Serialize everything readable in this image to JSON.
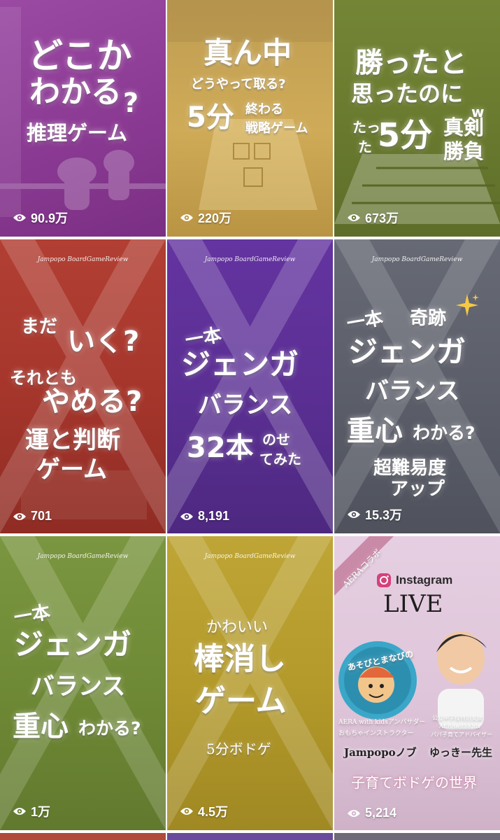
{
  "tiles": [
    {
      "lines": [
        "どこか",
        "わかる",
        "?",
        "推理ゲーム"
      ],
      "views": "90.9万"
    },
    {
      "lines": [
        "真ん中",
        "どうやって取る?",
        "5分",
        "終わる",
        "戦略ゲーム"
      ],
      "views": "220万"
    },
    {
      "lines": [
        "勝ったと",
        "思ったのに",
        "w",
        "たっ",
        "た",
        "5分",
        "真剣",
        "勝負"
      ],
      "views": "673万"
    },
    {
      "watermark": "Jampopo BoardGameReview",
      "lines": [
        "まだ",
        "いく?",
        "それとも",
        "やめる?",
        "運と判断",
        "ゲーム"
      ],
      "views": "701"
    },
    {
      "watermark": "Jampopo BoardGameReview",
      "lines": [
        "一本",
        "ジェンガ",
        "バランス",
        "32本",
        "のせ",
        "てみた"
      ],
      "views": "8,191"
    },
    {
      "watermark": "Jampopo BoardGameReview",
      "lines": [
        "一本",
        "奇跡",
        "ジェンガ",
        "バランス",
        "重心",
        "わかる?",
        "超難易度",
        "アップ"
      ],
      "views": "15.3万"
    },
    {
      "watermark": "Jampopo BoardGameReview",
      "lines": [
        "一本",
        "ジェンガ",
        "バランス",
        "重心",
        "わかる?"
      ],
      "views": "1万"
    },
    {
      "watermark": "Jampopo BoardGameReview",
      "lines": [
        "かわいい",
        "棒消し",
        "ゲーム",
        "5分ボドゲ"
      ],
      "views": "4.5万"
    },
    {
      "lines": [
        "AERAコラボ",
        "Instagram",
        "LIVE",
        "あそびとまなびの",
        "AERA with kidsアンバサダー",
        "おもちゃインストラクター",
        "公立中学校特別支援",
        "AERAwithKids",
        "パパ子育てアドバイザー",
        "Jampopoノブ",
        "ゆっきー先生",
        "子育てボドゲの世界"
      ],
      "views": "5,214"
    }
  ],
  "colors": {
    "tile_bg": [
      "#8e3b96",
      "#c6a24c",
      "#6b7d2f",
      "#a8352c",
      "#5b2f94",
      "#5c5f6a",
      "#6f8a36",
      "#b49a2a",
      "#dfc5d9"
    ],
    "view_text": "#ffffff"
  },
  "icons": {
    "views": "eye-icon"
  }
}
